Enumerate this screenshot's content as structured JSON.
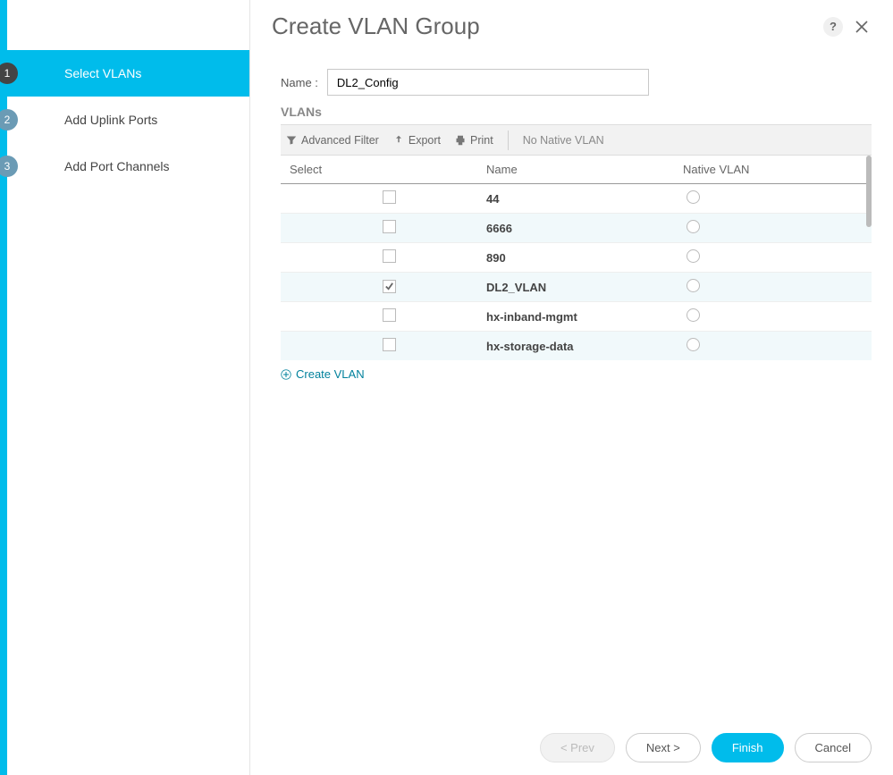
{
  "title": "Create VLAN Group",
  "steps": [
    {
      "num": "1",
      "label": "Select VLANs",
      "active": true
    },
    {
      "num": "2",
      "label": "Add Uplink Ports",
      "active": false
    },
    {
      "num": "3",
      "label": "Add Port Channels",
      "active": false
    }
  ],
  "form": {
    "name_label": "Name  :",
    "name_value": "DL2_Config"
  },
  "section_label": "VLANs",
  "toolbar": {
    "advanced_filter": "Advanced Filter",
    "export": "Export",
    "print": "Print",
    "no_native": "No Native VLAN"
  },
  "table": {
    "headers": {
      "select": "Select",
      "name": "Name",
      "native": "Native VLAN"
    },
    "rows": [
      {
        "selected": false,
        "name": "44",
        "native": false
      },
      {
        "selected": false,
        "name": "6666",
        "native": false
      },
      {
        "selected": false,
        "name": "890",
        "native": false
      },
      {
        "selected": true,
        "name": "DL2_VLAN",
        "native": false
      },
      {
        "selected": false,
        "name": "hx-inband-mgmt",
        "native": false
      },
      {
        "selected": false,
        "name": "hx-storage-data",
        "native": false
      }
    ]
  },
  "create_vlan_link": "Create VLAN",
  "footer": {
    "prev": "< Prev",
    "next": "Next >",
    "finish": "Finish",
    "cancel": "Cancel"
  }
}
